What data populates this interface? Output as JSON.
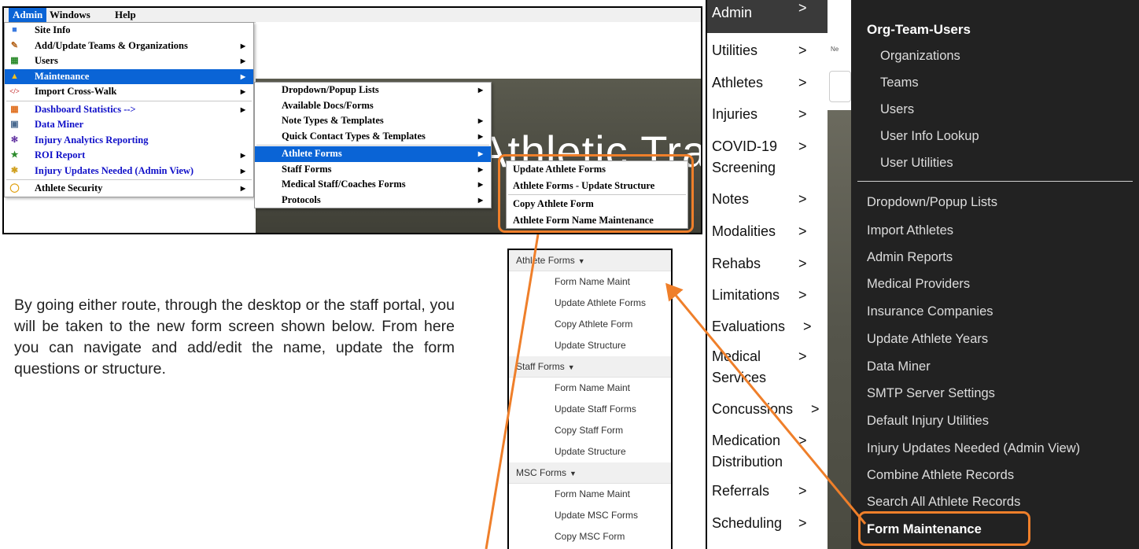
{
  "desktop": {
    "menubar": [
      "Admin",
      "Windows",
      "Help"
    ],
    "background_text": {
      "small": "e",
      "big": "Athletic Trai"
    },
    "admin_menu": [
      {
        "label": "Site Info",
        "icon": "site-info-icon",
        "submenu": false
      },
      {
        "label": "Add/Update Teams & Organizations",
        "icon": "teams-icon",
        "submenu": true
      },
      {
        "label": "Users",
        "icon": "users-icon",
        "submenu": true
      },
      {
        "label": "Maintenance",
        "icon": "maintenance-icon",
        "submenu": true,
        "highlighted": true
      },
      {
        "label": "Import Cross-Walk",
        "icon": "code-icon",
        "submenu": true
      },
      {
        "label": "Dashboard Statistics -->",
        "icon": "dashboard-icon",
        "submenu": true,
        "blue": true
      },
      {
        "label": "Data Miner",
        "icon": "data-miner-icon",
        "submenu": false,
        "blue": true
      },
      {
        "label": "Injury Analytics Reporting",
        "icon": "analytics-icon",
        "submenu": false,
        "blue": true
      },
      {
        "label": "ROI Report",
        "icon": "roi-icon",
        "submenu": true,
        "blue": true
      },
      {
        "label": "Injury Updates Needed (Admin View)",
        "icon": "injury-updates-icon",
        "submenu": true,
        "blue": true
      },
      {
        "label": "Athlete Security",
        "icon": "security-icon",
        "submenu": true
      }
    ],
    "maintenance_menu": [
      {
        "label": "Dropdown/Popup Lists",
        "submenu": true
      },
      {
        "label": "Available Docs/Forms",
        "submenu": false
      },
      {
        "label": "Note Types & Templates",
        "submenu": true
      },
      {
        "label": "Quick Contact Types & Templates",
        "submenu": true
      },
      {
        "label": "Athlete Forms",
        "submenu": true,
        "highlighted": true
      },
      {
        "label": "Staff Forms",
        "submenu": true
      },
      {
        "label": "Medical Staff/Coaches Forms",
        "submenu": true
      },
      {
        "label": "Protocols",
        "submenu": true
      }
    ],
    "athlete_forms_menu": [
      "Update Athlete Forms",
      "Athlete Forms - Update Structure",
      "Copy Athlete Form",
      "Athlete Form Name Maintenance"
    ]
  },
  "paragraph": "By going either route, through the desktop or the staff portal, you will be taken to the new form screen shown below. From here you can navigate and add/edit the name, update the form questions or structure.",
  "forms_list": [
    {
      "header": "Athlete Forms",
      "items": [
        "Form Name Maint",
        "Update Athlete Forms",
        "Copy Athlete Form",
        "Update Structure"
      ]
    },
    {
      "header": "Staff Forms",
      "items": [
        "Form Name Maint",
        "Update Staff Forms",
        "Copy Staff Form",
        "Update Structure"
      ]
    },
    {
      "header": "MSC Forms",
      "items": [
        "Form Name Maint",
        "Update MSC Forms",
        "Copy MSC Form"
      ]
    }
  ],
  "portal": {
    "strip_text": "Ne",
    "sidebar": [
      {
        "label": "Admin",
        "arrow": ">"
      },
      {
        "label": "Utilities",
        "arrow": ">"
      },
      {
        "label": "Athletes",
        "arrow": ">"
      },
      {
        "label": "Injuries",
        "arrow": ">"
      },
      {
        "label": "COVID-19 Screening",
        "arrow": ">"
      },
      {
        "label": "Notes",
        "arrow": ">"
      },
      {
        "label": "Modalities",
        "arrow": ">"
      },
      {
        "label": "Rehabs",
        "arrow": ">"
      },
      {
        "label": "Limitations",
        "arrow": ">"
      },
      {
        "label": "Evaluations",
        "arrow": ">"
      },
      {
        "label": "Medical Services",
        "arrow": ">"
      },
      {
        "label": "Concussions",
        "arrow": ">"
      },
      {
        "label": "Medication Distribution",
        "arrow": ">"
      },
      {
        "label": "Referrals",
        "arrow": ">"
      },
      {
        "label": "Scheduling",
        "arrow": ">"
      }
    ],
    "dropdown_title": "Org-Team-Users",
    "team_items": [
      "Organizations",
      "Teams",
      "Users",
      "User Info Lookup",
      "User Utilities"
    ],
    "admin_items": [
      "Dropdown/Popup Lists",
      "Import Athletes",
      "Admin Reports",
      "Medical Providers",
      "Insurance Companies",
      "Update Athlete Years",
      "Data Miner",
      "SMTP Server Settings",
      "Default Injury Utilities",
      "Injury Updates Needed (Admin View)",
      "Combine Athlete Records",
      "Search All Athlete Records",
      "Form Maintenance"
    ]
  },
  "colors": {
    "accent_orange": "#ef7f2a",
    "menu_highlight": "#0a64d6",
    "portal_dark": "#222222"
  }
}
